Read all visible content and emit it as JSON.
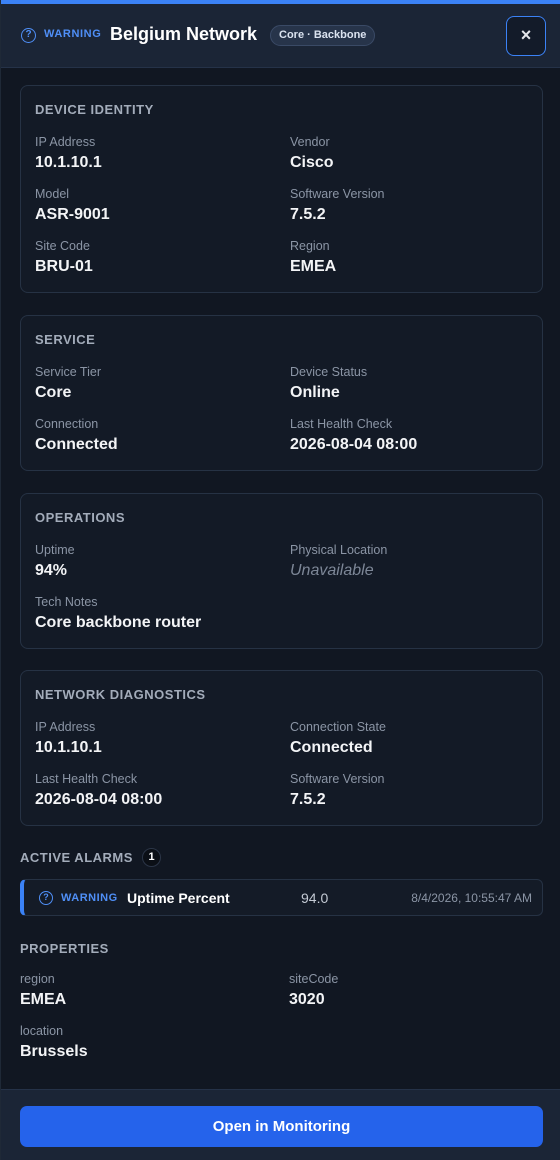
{
  "header": {
    "severity_icon": "question-circle-icon",
    "severity": "WARNING",
    "title": "Belgium Network",
    "badge": "Core · Backbone",
    "close_label": "×"
  },
  "device_identity": {
    "title": "DEVICE IDENTITY",
    "fields": [
      {
        "label": "IP Address",
        "value": "10.1.10.1"
      },
      {
        "label": "Vendor",
        "value": "Cisco"
      },
      {
        "label": "Model",
        "value": "ASR-9001"
      },
      {
        "label": "Software Version",
        "value": "7.5.2"
      },
      {
        "label": "Site Code",
        "value": "BRU-01"
      },
      {
        "label": "Region",
        "value": "EMEA"
      }
    ]
  },
  "service": {
    "title": "SERVICE",
    "fields": [
      {
        "label": "Service Tier",
        "value": "Core"
      },
      {
        "label": "Device Status",
        "value": "Online"
      },
      {
        "label": "Connection",
        "value": "Connected"
      },
      {
        "label": "Last Health Check",
        "value": "2026-08-04 08:00"
      }
    ]
  },
  "operations": {
    "title": "OPERATIONS",
    "fields": [
      {
        "label": "Uptime",
        "value": "94%"
      },
      {
        "label": "Physical Location",
        "value": "Unavailable"
      },
      {
        "label": "Tech Notes",
        "value": "Core backbone router"
      }
    ]
  },
  "network_diagnostics": {
    "title": "NETWORK DIAGNOSTICS",
    "fields": [
      {
        "label": "IP Address",
        "value": "10.1.10.1"
      },
      {
        "label": "Connection State",
        "value": "Connected"
      },
      {
        "label": "Last Health Check",
        "value": "2026-08-04 08:00"
      },
      {
        "label": "Software Version",
        "value": "7.5.2"
      }
    ]
  },
  "alarms": {
    "title": "ACTIVE ALARMS",
    "count": "1",
    "items": [
      {
        "icon": "question-circle-icon",
        "severity": "WARNING",
        "name": "Uptime Percent",
        "value": "94.0",
        "time": "8/4/2026, 10:55:47 AM"
      }
    ]
  },
  "properties": {
    "title": "PROPERTIES",
    "fields": [
      {
        "label": "region",
        "value": "EMEA"
      },
      {
        "label": "siteCode",
        "value": "3020"
      },
      {
        "label": "location",
        "value": "Brussels"
      }
    ]
  },
  "footer": {
    "button_label": "Open in Monitoring"
  },
  "colors": {
    "accent": "#3b82f6",
    "warning": "#4f8ff7",
    "background": "#111722",
    "card": "#131a26"
  }
}
